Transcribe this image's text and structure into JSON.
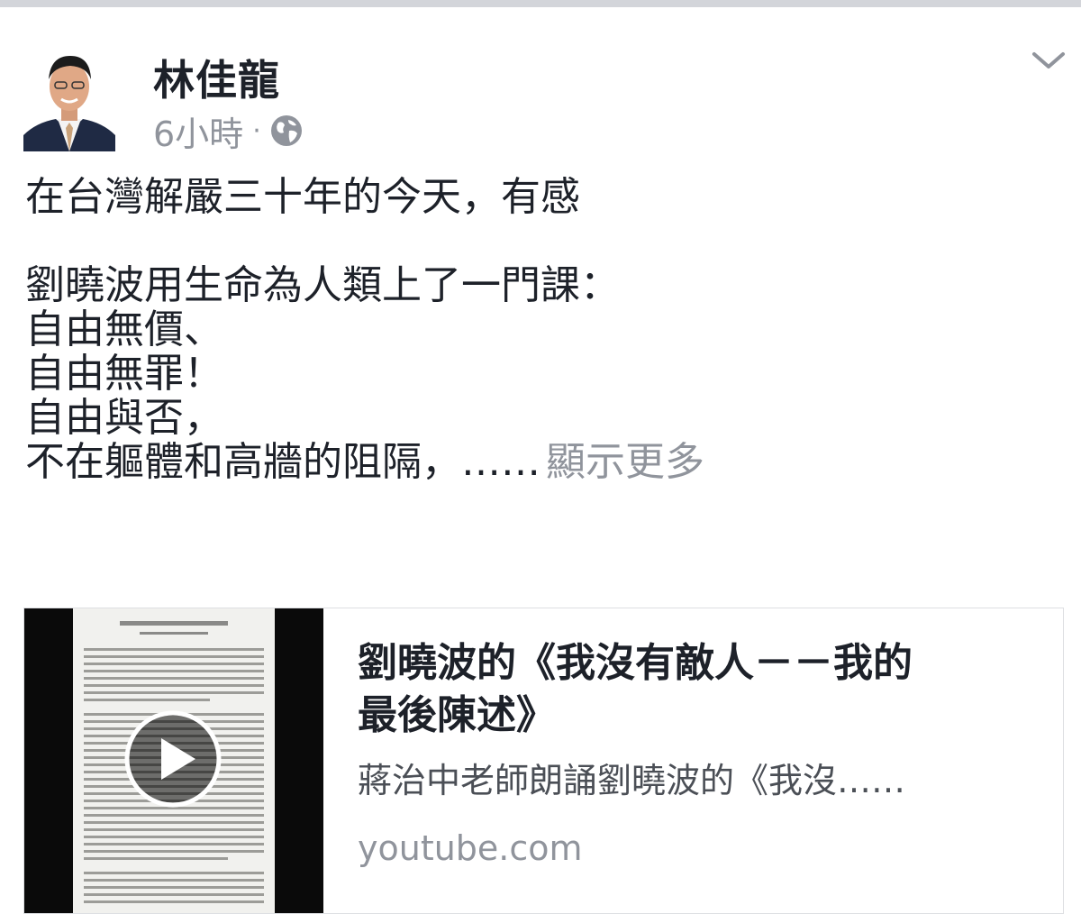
{
  "post": {
    "author": "林佳龍",
    "time": "6小時",
    "separator": "·",
    "privacy_icon": "globe-icon",
    "menu_icon": "chevron-down-icon",
    "lines": [
      "在台灣解嚴三十年的今天，有感",
      "",
      "劉曉波用生命為人類上了一門課：",
      "自由無價、",
      "自由無罪！",
      "自由與否，",
      "不在軀體和高牆的阻隔，……"
    ],
    "see_more": "顯示更多"
  },
  "link_card": {
    "thumbnail_icon": "play-icon",
    "title_line1": "劉曉波的《我沒有敵人－－我的",
    "title_line2": "最後陳述》",
    "description": "蔣治中老師朗誦劉曉波的《我沒……",
    "domain": "youtube.com"
  },
  "colors": {
    "text": "#1d2129",
    "secondary": "#90949c",
    "border": "#dddfe2"
  }
}
